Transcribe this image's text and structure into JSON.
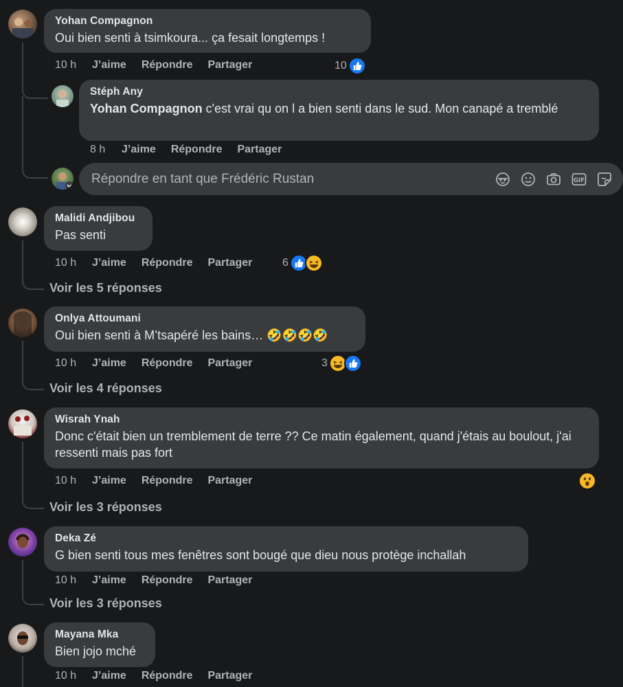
{
  "actions": {
    "like": "J’aime",
    "reply": "Répondre",
    "share": "Partager"
  },
  "comments": [
    {
      "author": "Yohan Compagnon",
      "text": "Oui bien senti à tsimkoura... ça fesait longtemps !",
      "time": "10 h",
      "react_count": "10"
    },
    {
      "author": "Malidi Andjibou",
      "text": "Pas senti",
      "time": "10 h",
      "react_count": "6",
      "more": "Voir les 5 réponses"
    },
    {
      "author": "Onlya Attoumani",
      "text": "Oui bien senti à M’tsapéré les bains… 🤣🤣🤣🤣",
      "time": "10 h",
      "react_count": "3",
      "more": "Voir les 4 réponses"
    },
    {
      "author": "Wisrah Ynah",
      "text": "Donc c'était bien un tremblement de terre ?? Ce matin également, quand j'étais au boulout, j'ai ressenti mais pas fort",
      "time": "10 h",
      "react_count": "",
      "more": "Voir les 3 réponses"
    },
    {
      "author": "Deka Zé",
      "text": "G bien senti tous mes fenêtres sont bougé que dieu nous protège inchallah",
      "time": "10 h",
      "react_count": "",
      "more": "Voir les 3 réponses"
    },
    {
      "author": "Mayana Mka",
      "text": "Bien jojo mché",
      "time": "10 h",
      "react_count": ""
    }
  ],
  "reply": {
    "author": "Stéph Any",
    "mention": "Yohan Compagnon",
    "text": " c'est vrai qu on l a bien senti dans le sud. Mon canapé a tremblé",
    "time": "8 h"
  },
  "composer": {
    "placeholder": "Répondre en tant que Frédéric Rustan"
  },
  "composer_tools": [
    "avatar-sticker-icon",
    "emoji-icon",
    "camera-icon",
    "gif-icon",
    "sticker-icon"
  ],
  "colors": {
    "background": "#18191a",
    "bubble": "#3a3b3c",
    "like": "#1877f2",
    "haha": "#f7b928",
    "muted": "#b0b3b8"
  }
}
